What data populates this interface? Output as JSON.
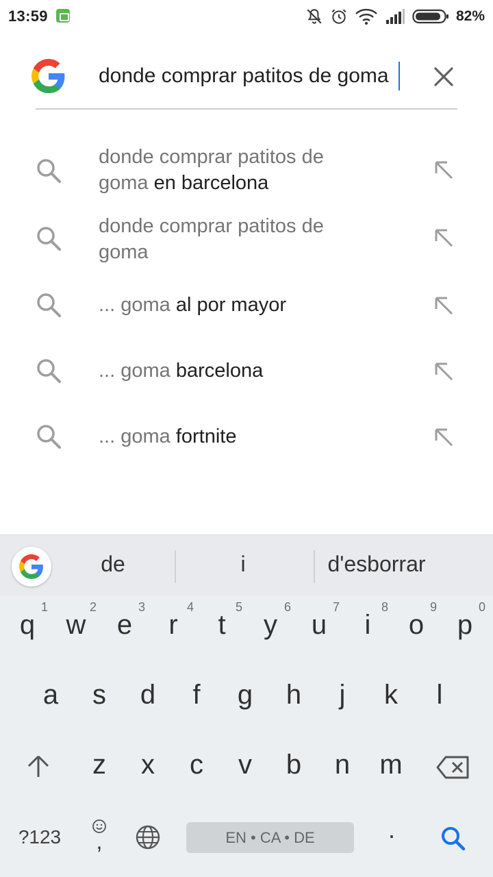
{
  "status_bar": {
    "time": "13:59",
    "battery_percent": "82%",
    "icons": [
      "app-notification-icon",
      "bell-off-icon",
      "alarm-icon",
      "wifi-icon",
      "signal-icon",
      "battery-icon"
    ]
  },
  "search": {
    "query": "donde comprar patitos de goma",
    "logo": "google-g-icon",
    "clear_icon": "close-icon"
  },
  "suggestions": [
    {
      "prefix": "donde comprar patitos de goma ",
      "completion": "en barcelona",
      "line1": "donde comprar patitos de",
      "line2_prefix": "goma ",
      "line2_bold": "en barcelona"
    },
    {
      "prefix": "donde comprar patitos de goma",
      "completion": "",
      "line1": "donde comprar patitos de",
      "line2_prefix": "goma",
      "line2_bold": ""
    },
    {
      "prefix": "... goma ",
      "completion": "al por mayor"
    },
    {
      "prefix": "... goma ",
      "completion": "barcelona"
    },
    {
      "prefix": "... goma ",
      "completion": "fortnite"
    }
  ],
  "keyboard": {
    "suggestions": [
      "de",
      "i",
      "d'esborrar"
    ],
    "row1": [
      {
        "k": "q",
        "n": "1"
      },
      {
        "k": "w",
        "n": "2"
      },
      {
        "k": "e",
        "n": "3"
      },
      {
        "k": "r",
        "n": "4"
      },
      {
        "k": "t",
        "n": "5"
      },
      {
        "k": "y",
        "n": "6"
      },
      {
        "k": "u",
        "n": "7"
      },
      {
        "k": "i",
        "n": "8"
      },
      {
        "k": "o",
        "n": "9"
      },
      {
        "k": "p",
        "n": "0"
      }
    ],
    "row2": [
      "a",
      "s",
      "d",
      "f",
      "g",
      "h",
      "j",
      "k",
      "l"
    ],
    "row3": [
      "z",
      "x",
      "c",
      "v",
      "b",
      "n",
      "m"
    ],
    "symbols_label": "?123",
    "comma": ",",
    "period": ".",
    "space_label": "EN • CA • DE"
  },
  "colors": {
    "accent": "#1a73e8",
    "google_blue": "#4285F4",
    "google_red": "#EA4335",
    "google_yellow": "#FBBC05",
    "google_green": "#34A853"
  }
}
